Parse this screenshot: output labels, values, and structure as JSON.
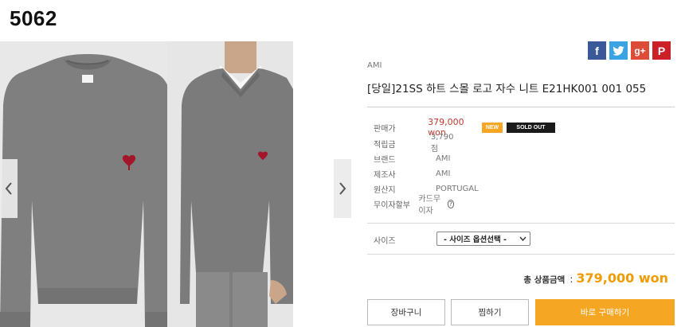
{
  "page_label": "5062",
  "share": {
    "facebook": "f",
    "twitter": "t",
    "googleplus": "g+",
    "pinterest": "P"
  },
  "product": {
    "brand": "AMI",
    "title": "[당일]21SS 하트 스몰 로고 자수 니트 E21HK001 001 055"
  },
  "info": {
    "price_label": "판매가",
    "price": "379,000 won",
    "badge_new": "NEW",
    "badge_sold": "SOLD OUT",
    "points_label": "적립금",
    "points": "3,790점",
    "brand_label": "브랜드",
    "brand": "AMI",
    "maker_label": "제조사",
    "maker": "AMI",
    "origin_label": "원산지",
    "origin": "PORTUGAL",
    "installment_label": "무이자할부",
    "installment": "카드무이자"
  },
  "option": {
    "size_label": "사이즈",
    "size_selected": "- 사이즈 옵션선택 -"
  },
  "total": {
    "label": "총 상품금액",
    "colon": ":",
    "amount": "379,000 won"
  },
  "buttons": {
    "cart": "장바구니",
    "wish": "찜하기",
    "buy": "바로 구매하기"
  },
  "colors": {
    "accent": "#f5a623",
    "price_red": "#c0392b",
    "sweater_gray": "#7d7d7d"
  }
}
